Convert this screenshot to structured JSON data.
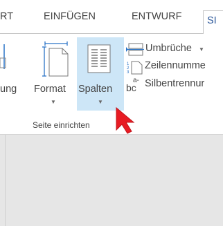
{
  "tabs": [
    {
      "label": "RT"
    },
    {
      "label": "EINFÜGEN"
    },
    {
      "label": "ENTWURF"
    },
    {
      "label": "SEITENLAYOUT"
    }
  ],
  "active_tab_visible_text": "SI",
  "ribbon": {
    "left_cut_label": "ung",
    "format_label": "Format",
    "spalten_label": "Spalten",
    "umbrueche_label": "Umbrüche",
    "zeilennummern_label": "Zeilennumme",
    "silbentrennung_label": "Silbentrennur",
    "group_label": "Seite einrichten"
  },
  "icons": {
    "format": "page-size-icon",
    "spalten": "columns-icon",
    "umbrueche": "breaks-icon",
    "zeilennummern": "line-numbers-icon",
    "silbentrennung": "hyphenation-icon",
    "pointer": "red-arrow-cursor-icon"
  },
  "colors": {
    "highlight": "#cde6f7",
    "active_tab_text": "#2b579a",
    "cursor": "#e81b23",
    "doc_background": "#e6e6e6"
  }
}
